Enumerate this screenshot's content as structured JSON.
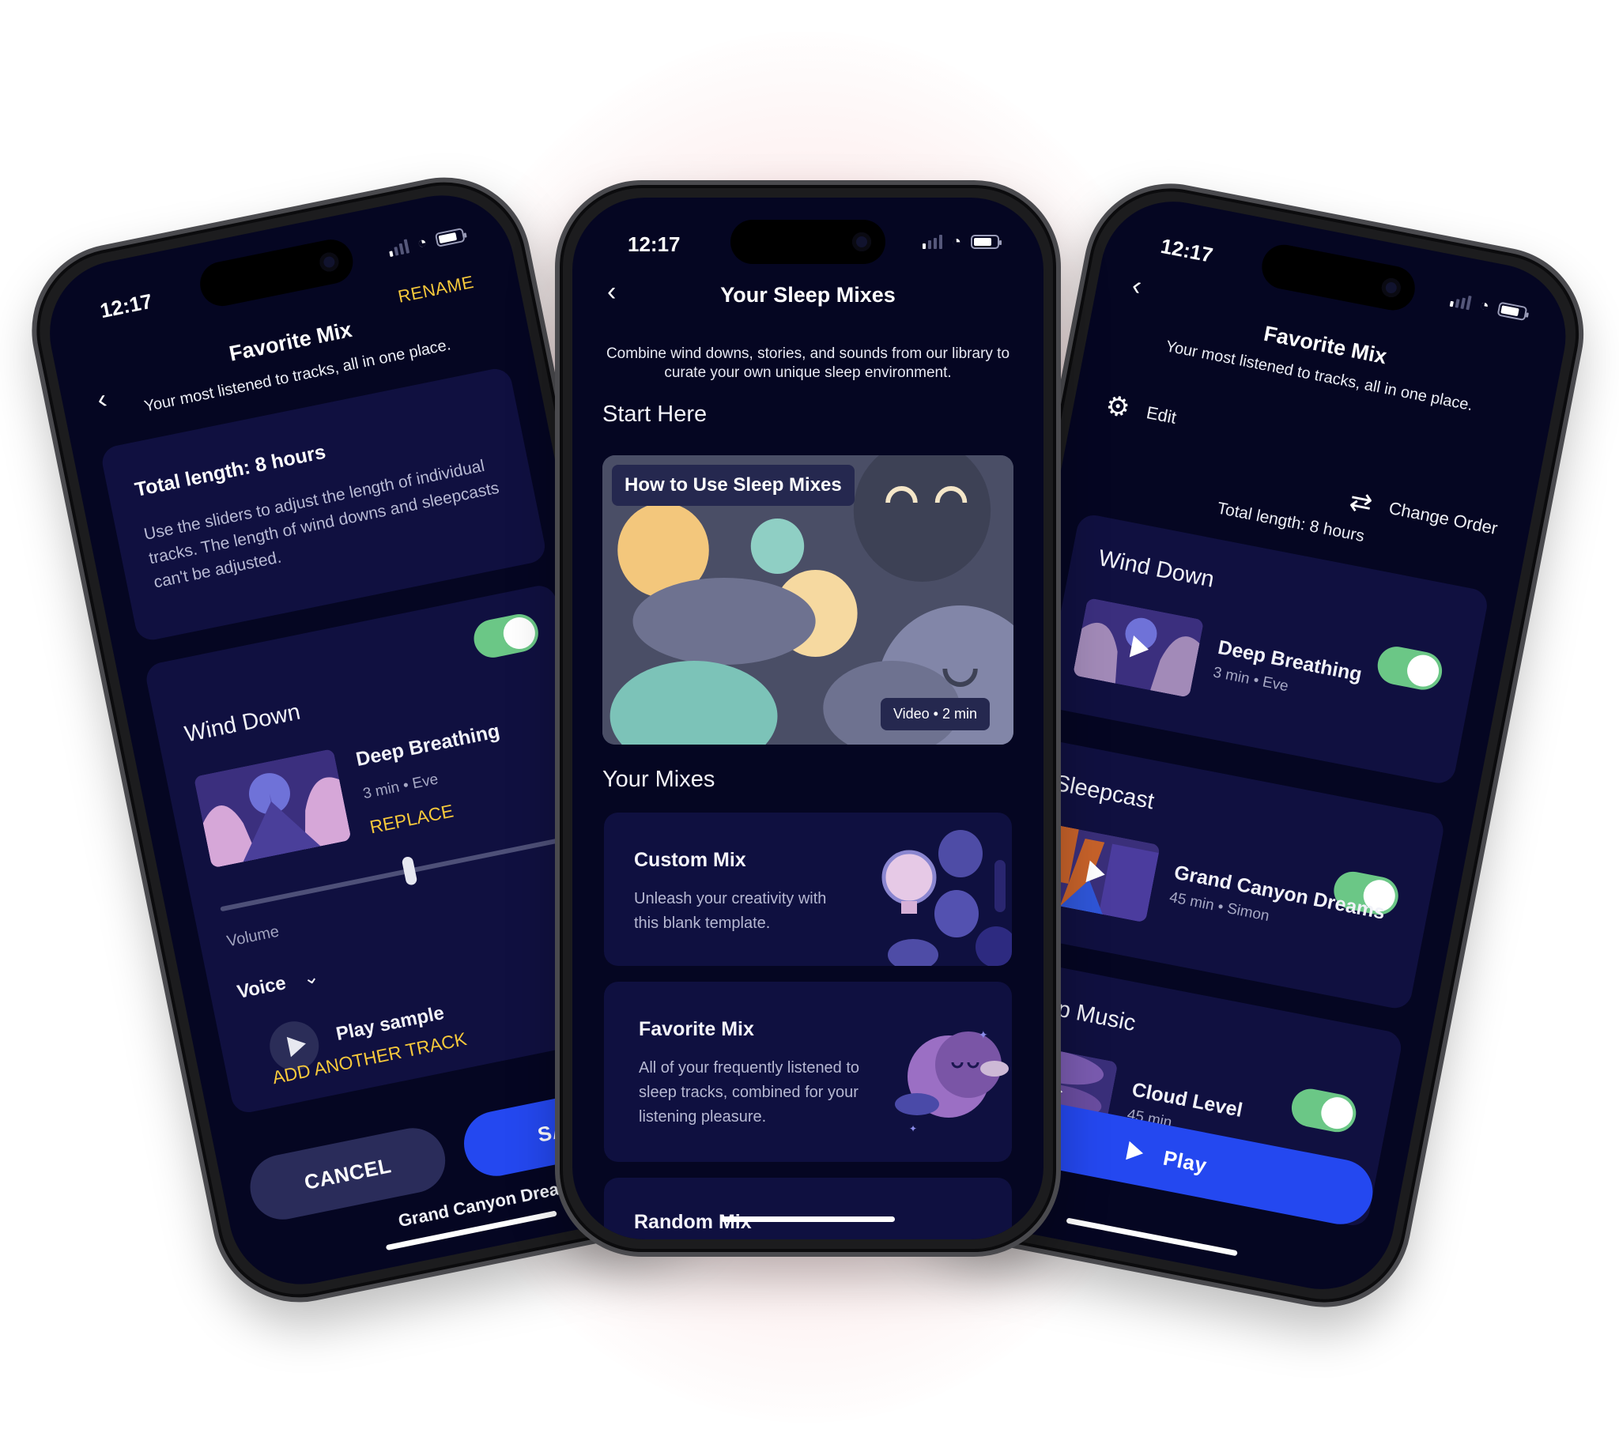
{
  "colors": {
    "screen_bg": "#050622",
    "card_bg": "#101040",
    "accent_yellow": "#f7c93b",
    "toggle_on": "#6bc786",
    "primary_blue": "#2448f0",
    "glow_pink": "#e28c96"
  },
  "status_bar": {
    "time": "12:17",
    "signal_icon": "cellular-signal-icon",
    "wifi_icon": "wifi-icon",
    "battery_icon": "battery-icon"
  },
  "center_phone": {
    "title": "Your Sleep Mixes",
    "back_icon": "chevron-left-icon",
    "intro": "Combine wind downs, stories, and sounds from our library to curate your own unique sleep environment.",
    "start_here_heading": "Start Here",
    "video_card": {
      "title": "How to Use Sleep Mixes",
      "meta": "Video • 2 min"
    },
    "your_mixes_heading": "Your Mixes",
    "mixes": [
      {
        "title": "Custom Mix",
        "description": "Unleash your creativity with this blank template.",
        "illustration": "lightbulbs-illustration"
      },
      {
        "title": "Favorite Mix",
        "description": "All of your frequently listened to sleep tracks, combined for your listening pleasure.",
        "illustration": "sleeping-moon-illustration"
      },
      {
        "title": "Random Mix"
      }
    ]
  },
  "left_phone": {
    "title": "Favorite Mix",
    "rename_label": "RENAME",
    "subtitle": "Your most listened to tracks, all in one place.",
    "info_title": "Total length: 8 hours",
    "info_text": "Use the sliders to adjust the length of individual tracks. The length of wind downs and sleepcasts can't be adjusted.",
    "section": "Wind Down",
    "toggle_on": true,
    "track": {
      "name": "Deep Breathing",
      "meta": "3 min • Eve"
    },
    "replace_label": "REPLACE",
    "volume_label": "Volume",
    "volume_value": 0.48,
    "voice_label": "Voice",
    "play_sample_label": "Play sample",
    "add_track_label": "ADD ANOTHER TRACK",
    "cancel_label": "CANCEL",
    "save_label": "SAVE",
    "peek_track": "Grand Canyon Dreams"
  },
  "right_phone": {
    "title": "Favorite Mix",
    "subtitle": "Your most listened to tracks, all in one place.",
    "edit_label": "Edit",
    "change_order_label": "Change Order",
    "total_length": "Total length: 8 hours",
    "sections": [
      {
        "heading": "Wind Down",
        "track": "Deep Breathing",
        "meta": "3 min • Eve",
        "enabled": true
      },
      {
        "heading": "Sleepcast",
        "track": "Grand Canyon Dreams",
        "meta": "45 min • Simon",
        "enabled": true
      },
      {
        "heading": "Sleep Music",
        "track": "Cloud Level",
        "meta": "45 min",
        "enabled": true
      }
    ],
    "play_label": "Play"
  }
}
